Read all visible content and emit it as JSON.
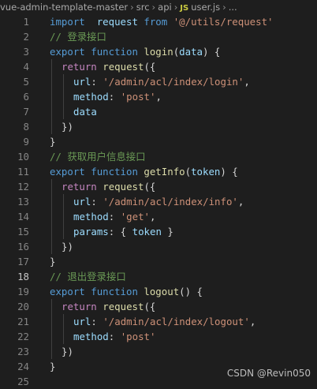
{
  "breadcrumb": {
    "project": "vue-admin-template-master",
    "folder1": "src",
    "folder2": "api",
    "file_icon": "JS",
    "file": "user.js",
    "more": "..."
  },
  "editor": {
    "active_line": 18,
    "lines": [
      {
        "n": "1",
        "t": [
          [
            "kw",
            "import"
          ],
          [
            "",
            "  "
          ],
          [
            "var",
            "request"
          ],
          [
            "",
            " "
          ],
          [
            "kw",
            "from"
          ],
          [
            "",
            " "
          ],
          [
            "str",
            "'@/utils/request'"
          ]
        ]
      },
      {
        "n": "2",
        "t": [
          [
            "cmt",
            "// 登录接口"
          ]
        ]
      },
      {
        "n": "3",
        "t": [
          [
            "kw",
            "export"
          ],
          [
            "",
            " "
          ],
          [
            "kw",
            "function"
          ],
          [
            "",
            " "
          ],
          [
            "fn",
            "login"
          ],
          [
            "",
            "("
          ],
          [
            "var",
            "data"
          ],
          [
            "",
            ") {"
          ]
        ]
      },
      {
        "n": "4",
        "t": [
          [
            "",
            ""
          ],
          [
            "ctl",
            "return"
          ],
          [
            "",
            " "
          ],
          [
            "fn",
            "request"
          ],
          [
            "",
            "({"
          ]
        ],
        "indent": 1
      },
      {
        "n": "5",
        "t": [
          [
            "var",
            "url"
          ],
          [
            "",
            ": "
          ],
          [
            "str",
            "'/admin/acl/index/login'"
          ],
          [
            "",
            ","
          ]
        ],
        "indent": 2
      },
      {
        "n": "6",
        "t": [
          [
            "var",
            "method"
          ],
          [
            "",
            ": "
          ],
          [
            "str",
            "'post'"
          ],
          [
            "",
            ","
          ]
        ],
        "indent": 2
      },
      {
        "n": "7",
        "t": [
          [
            "var",
            "data"
          ]
        ],
        "indent": 2
      },
      {
        "n": "8",
        "t": [
          [
            "",
            "})"
          ]
        ],
        "indent": 1
      },
      {
        "n": "9",
        "t": [
          [
            "",
            "}"
          ]
        ]
      },
      {
        "n": "10",
        "t": [
          [
            "cmt",
            "// 获取用户信息接口"
          ]
        ]
      },
      {
        "n": "11",
        "t": [
          [
            "kw",
            "export"
          ],
          [
            "",
            " "
          ],
          [
            "kw",
            "function"
          ],
          [
            "",
            " "
          ],
          [
            "fn",
            "getInfo"
          ],
          [
            "",
            "("
          ],
          [
            "var",
            "token"
          ],
          [
            "",
            ") {"
          ]
        ]
      },
      {
        "n": "12",
        "t": [
          [
            "ctl",
            "return"
          ],
          [
            "",
            " "
          ],
          [
            "fn",
            "request"
          ],
          [
            "",
            "({"
          ]
        ],
        "indent": 1
      },
      {
        "n": "13",
        "t": [
          [
            "var",
            "url"
          ],
          [
            "",
            ": "
          ],
          [
            "str",
            "'/admin/acl/index/info'"
          ],
          [
            "",
            ","
          ]
        ],
        "indent": 2
      },
      {
        "n": "14",
        "t": [
          [
            "var",
            "method"
          ],
          [
            "",
            ": "
          ],
          [
            "str",
            "'get'"
          ],
          [
            "",
            ","
          ]
        ],
        "indent": 2
      },
      {
        "n": "15",
        "t": [
          [
            "var",
            "params"
          ],
          [
            "",
            ": { "
          ],
          [
            "var",
            "token"
          ],
          [
            "",
            " }"
          ]
        ],
        "indent": 2
      },
      {
        "n": "16",
        "t": [
          [
            "",
            "})"
          ]
        ],
        "indent": 1
      },
      {
        "n": "17",
        "t": [
          [
            "",
            "}"
          ]
        ]
      },
      {
        "n": "18",
        "t": [
          [
            "cmt",
            "// 退出登录接口"
          ]
        ]
      },
      {
        "n": "19",
        "t": [
          [
            "kw",
            "export"
          ],
          [
            "",
            " "
          ],
          [
            "kw",
            "function"
          ],
          [
            "",
            " "
          ],
          [
            "fn",
            "logout"
          ],
          [
            "",
            "() {"
          ]
        ]
      },
      {
        "n": "20",
        "t": [
          [
            "ctl",
            "return"
          ],
          [
            "",
            " "
          ],
          [
            "fn",
            "request"
          ],
          [
            "",
            "({"
          ]
        ],
        "indent": 1
      },
      {
        "n": "21",
        "t": [
          [
            "var",
            "url"
          ],
          [
            "",
            ": "
          ],
          [
            "str",
            "'/admin/acl/index/logout'"
          ],
          [
            "",
            ","
          ]
        ],
        "indent": 2
      },
      {
        "n": "22",
        "t": [
          [
            "var",
            "method"
          ],
          [
            "",
            ": "
          ],
          [
            "str",
            "'post'"
          ]
        ],
        "indent": 2
      },
      {
        "n": "23",
        "t": [
          [
            "",
            "})"
          ]
        ],
        "indent": 1
      },
      {
        "n": "24",
        "t": [
          [
            "",
            "}"
          ]
        ]
      },
      {
        "n": "25",
        "t": []
      }
    ]
  },
  "watermark": "CSDN @Revin050",
  "colors": {
    "background": "#1e1e1e",
    "keyword": "#569cd6",
    "control": "#c586c0",
    "function": "#dcdcaa",
    "string": "#ce9178",
    "variable": "#9cdcfe",
    "comment": "#6a9955"
  }
}
